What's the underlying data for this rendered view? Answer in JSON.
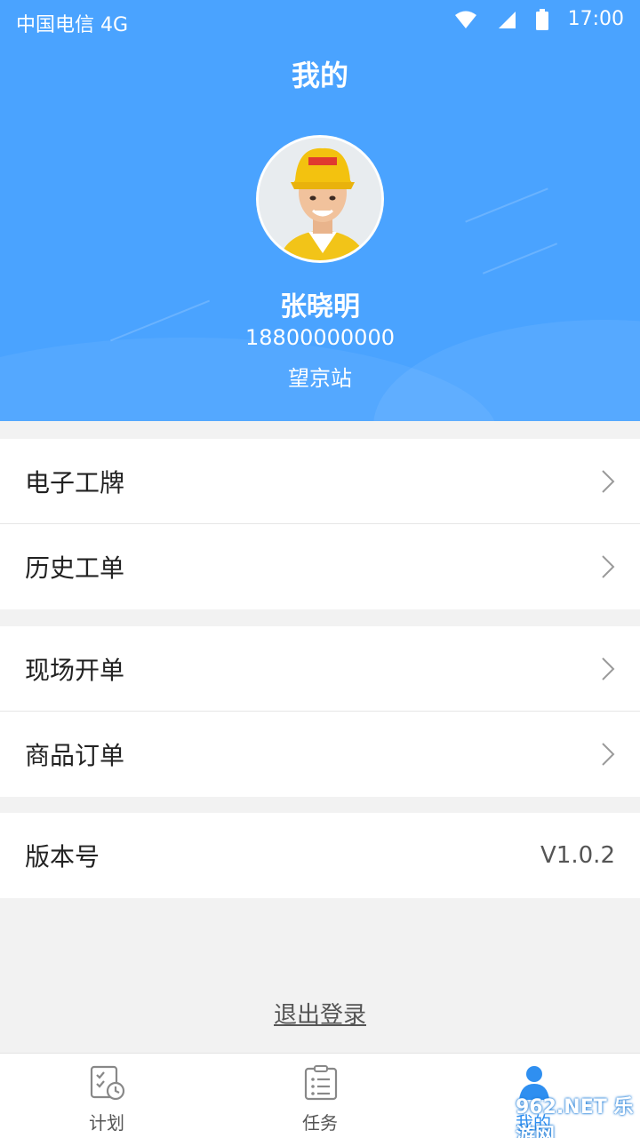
{
  "status_bar": {
    "carrier": "中国电信 4G",
    "time": "17:00"
  },
  "header": {
    "title": "我的"
  },
  "profile": {
    "name": "张晓明",
    "phone": "18800000000",
    "station": "望京站"
  },
  "menu_groups": [
    [
      {
        "label": "电子工牌"
      },
      {
        "label": "历史工单"
      }
    ],
    [
      {
        "label": "现场开单"
      },
      {
        "label": "商品订单"
      }
    ]
  ],
  "version": {
    "label": "版本号",
    "value": "V1.0.2"
  },
  "logout_label": "退出登录",
  "tabs": [
    {
      "label": "计划",
      "icon": "plan-icon"
    },
    {
      "label": "任务",
      "icon": "task-icon"
    },
    {
      "label": "我的",
      "icon": "profile-icon"
    }
  ],
  "watermark": "962.NET 乐游网",
  "colors": {
    "primary": "#4aa3ff",
    "background": "#f2f2f2"
  }
}
